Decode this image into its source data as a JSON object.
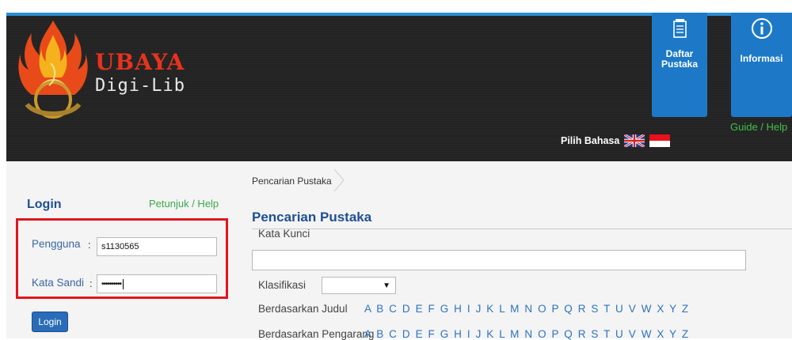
{
  "header": {
    "brand_title": "UBAYA",
    "brand_sub": "Digi-Lib",
    "tiles": [
      {
        "label_line1": "Daftar",
        "label_line2": "Pustaka",
        "icon": "list-icon"
      },
      {
        "label": "Informasi",
        "icon": "info-icon"
      }
    ],
    "language_label": "Pilih Bahasa",
    "guide_link": "Guide / Help"
  },
  "login": {
    "title": "Login",
    "help_link": "Petunjuk / Help",
    "username_label": "Pengguna",
    "username_value": "s1130565",
    "password_label": "Kata Sandi",
    "password_value": "••••••••••",
    "colon": ":",
    "button_label": "Login"
  },
  "search": {
    "breadcrumb": "Pencarian Pustaka",
    "title": "Pencarian Pustaka",
    "keyword_label": "Kata Kunci",
    "keyword_value": "",
    "classification_label": "Klasifikasi",
    "classification_value": "",
    "by_title_label": "Berdasarkan Judul",
    "by_author_label": "Berdasarkan Pengarang",
    "alphabet": "A B C D E F G H I J K L M N O P Q R S T U V W X Y Z"
  },
  "colors": {
    "header_bg": "#232323",
    "tile_blue": "#1d79c7",
    "brand_red": "#e8321e",
    "link_green": "#39a94a",
    "title_blue": "#1f4f93",
    "highlight_red": "#e0161c"
  }
}
